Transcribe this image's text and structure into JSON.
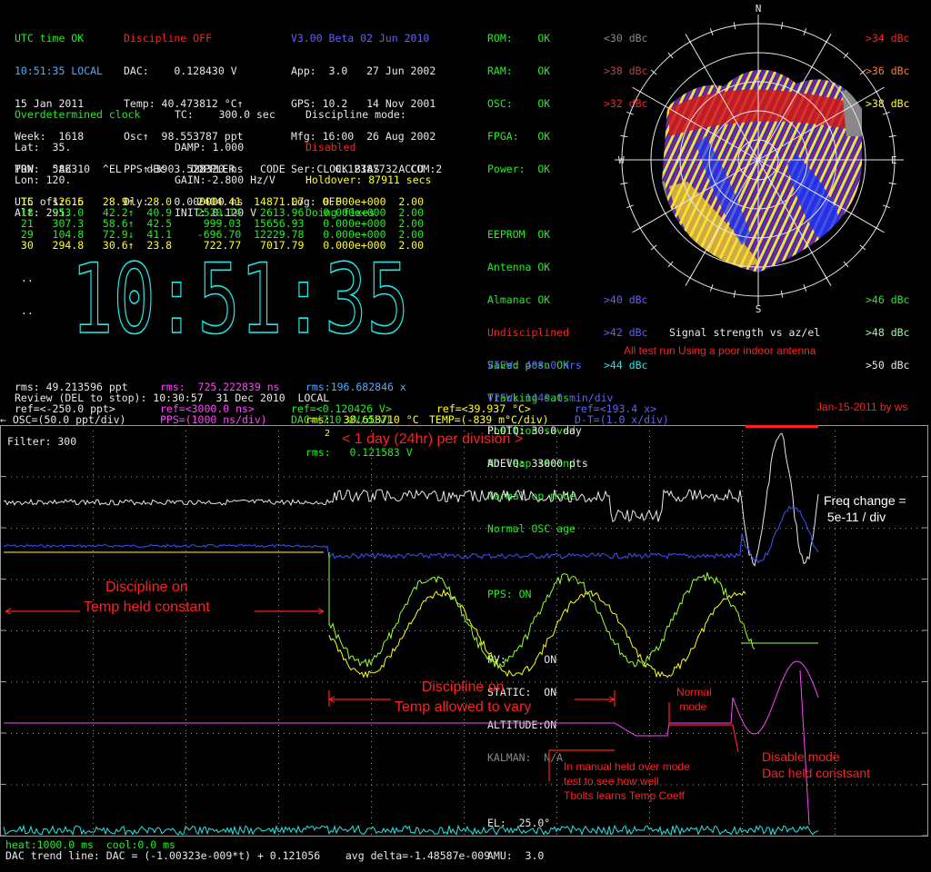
{
  "status": {
    "utc_time_ok": "UTC time OK",
    "discipline_off": "Discipline OFF",
    "version": "V3.00 Beta 02 Jun 2010",
    "local_time": "10:51:35 LOCAL",
    "date": "15 Jan 2011",
    "week": "Week:  1618",
    "tow": "TOW:  586310",
    "utc_ofs": "UTC ofs: 15",
    "dac": "DAC:    0.128430 V",
    "temp": "Temp: 40.473812 °C↑",
    "osc": "Osc↑  98.553787 ppt",
    "pps": "PPS↑-3903.528320 ns",
    "dly": "Dly:    0.000000 ns",
    "app": "App:  3.0   27 Jun 2002",
    "gps": "GPS: 10.2   14 Nov 2001",
    "mfg": "Mfg: 16:00  26 Aug 2002",
    "ser": "Ser:   0.12387732  COM:2",
    "log": "Log: OFF"
  },
  "position": {
    "mode": "Overdetermined clock",
    "lat": "Lat:  35.",
    "lon": "Lon: 120.",
    "alt": "Alt: 295.",
    "tc": "TC:    300.0 sec",
    "damp": "DAMP: 1.000",
    "gain": "GAIN:-2.800 Hz/V",
    "init": "INIT: 0.120 V",
    "disc_mode_label": "Discipline mode:",
    "disc_disabled": "Disabled",
    "holdover": "Holdover: 87911 secs",
    "doing_fixes": "Doing fixes"
  },
  "sat_table": {
    "header": "PRN   ^AZ     ^EL    dBc    DOPPLER    CODE     CLOCK BIAS   ACCU",
    "rows": [
      {
        "text": " 15   126.6   28.9↑  28.0    2404.41  14871.07   0.000e+000  2.00",
        "color": "#ffff22"
      },
      {
        "text": " 18   213.0   42.2↑  40.9    2520.14   2613.96   0.000e+000  2.00",
        "color": "#22ee22"
      },
      {
        "text": " 21   307.3   58.6↑  42.5     999.03  15656.93   0.000e+000  2.00",
        "color": "#22ee22"
      },
      {
        "text": " 29   104.8   72.9↓  41.1    -696.70  12229.78   0.000e+000  2.00",
        "color": "#22ee22"
      },
      {
        "text": " 30   294.8   30.6↑  23.8     722.77   7017.79   0.000e+000  2.00",
        "color": "#ffff22"
      }
    ],
    "dots1": " ..",
    "dots2": " .."
  },
  "health": {
    "rom": "ROM:    OK",
    "ram": "RAM:    OK",
    "osc": "OSC:    OK",
    "fpga": "FPGA:   OK",
    "power": "Power:  OK",
    "eeprom": "EEPROM  OK",
    "antenna": "Antenna OK",
    "almanac": "Almanac OK",
    "undisciplined": "Undisciplined",
    "saved_posn": "Saved posn OK",
    "tracking": "Tracking sats",
    "pos_saved": "Position saved",
    "no_leap": "No leap second",
    "normal_op": "Normal op mode",
    "normal_osc": "Normal OSC age",
    "pps_on": "PPS: ON",
    "pv": "PV:      ON",
    "static": "STATIC:  ON",
    "altitude": "ALTITUDE:ON",
    "kalman": "KALMAN:  N/A",
    "el": "EL:  25.0°",
    "amu": "AMU:  3.0"
  },
  "signal_legend": {
    "lt30": "<30 dBc",
    "gt38a": ">38 dBc",
    "gt32": ">32 dBc",
    "gt34": ">34 dBc",
    "gt36": ">36 dBc",
    "gt38b": ">38 dBc",
    "gt40": ">40 dBc",
    "gt42": ">42 dBc",
    "gt44": ">44 dBc",
    "gt46": ">46 dBc",
    "gt48": ">48 dBc",
    "gt50": ">50 dBc",
    "n": "N",
    "s": "S",
    "e": "E",
    "w": "W",
    "caption": "Signal strength vs az/el"
  },
  "clock": {
    "time": "10:51:35"
  },
  "stats": {
    "view1": "VIEW: 408.0 hrs",
    "view2": "VIEW: 1440.0 min/div",
    "plotq": "PLOTQ: 30.0 day",
    "adevq": "ADEVQ: 33000 pts",
    "rms_x": "rms:196.682846 x",
    "rms_c": "rms:  38.658710 °C",
    "rms_v": "rms:   0.121583 V",
    "rms_ppt": "rms: 49.213596 ppt",
    "rms_ns": "rms:  725.222839 ns",
    "review": "Review (DEL to stop): 10:30:57  31 Dec 2010  LOCAL",
    "ref_ppt": "ref=<-250.0 ppt>",
    "ref_ns": "ref=<3000.0 ns>",
    "ref_v": "ref=<0.120426 V>",
    "ref_c": "ref=<39.937 °C>",
    "ref_x": "ref=<193.4 x>",
    "osc_div": "← OSC=(50.0 ppt/div)",
    "pps_div": "PPS=(1000 ns/div)",
    "dac_div": "DAC=(710 uV/div)",
    "temp_div": "TEMP=(-839 m°C/div)",
    "dt_div": "D-T=(1.0 x/div)",
    "filter": "Filter: 300",
    "heat": "heat:1000.0 ms  cool:0.0 ms",
    "trend": "DAC trend line: DAC = (-1.00323e-009*t) + 0.121056    avg delta=-1.48587e-009",
    "marker": "2"
  },
  "annotations": {
    "poor_antenna": "All test run Using a poor indoor antenna",
    "byline": "Jan-15-2011 by ws",
    "per_div": "< 1 day (24hr) per division >",
    "freq_change": "Freq change =\n 5e-11 / div",
    "disc_on_const": "Discipline on\nTemp held constant",
    "disc_on_vary": "Discipline on\nTemp allowed to vary",
    "normal_mode": "Normal\n mode",
    "disable_mode": "Disable mode\nDac held constsant",
    "manual_hold": "In manual held over mode\ntest to see how well\nTbolts learns Temp Coeff"
  },
  "colors": {
    "osc": "#e8e8e8",
    "pps": "#ff44ff",
    "dac": "#99ff33",
    "temp": "#ffff22",
    "dt": "#3a55ff",
    "heat": "#22e8e8",
    "grid": "#9a9a9a"
  }
}
